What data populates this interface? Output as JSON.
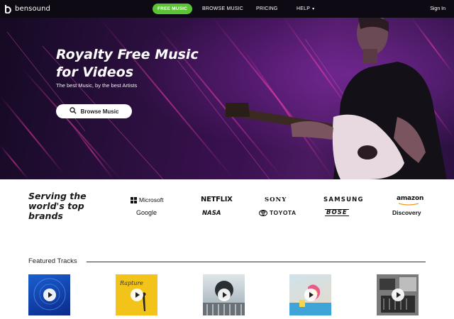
{
  "nav": {
    "logo_text": "bensound",
    "links": {
      "free_music": "FREE MUSIC",
      "browse_music": "BROWSE MUSIC",
      "pricing": "PRICING",
      "help": "HELP"
    },
    "sign_in": "Sign In"
  },
  "hero": {
    "title_line1": "Royalty Free Music",
    "title_line2": "for Videos",
    "subtitle": "The best Music, by the best Artists",
    "button_label": "Browse Music"
  },
  "brands": {
    "title_line1": "Serving the",
    "title_line2": "world's top",
    "title_line3": "brands",
    "logos": {
      "microsoft": "Microsoft",
      "netflix": "NETFLIX",
      "sony": "SONY",
      "samsung": "SAMSUNG",
      "amazon": "amazon",
      "google": "Google",
      "nasa": "NASA",
      "toyota": "TOYOTA",
      "bose": "BOSE",
      "discovery": "Discovery"
    }
  },
  "featured": {
    "title": "Featured Tracks",
    "track_cover_texts": {
      "track2": "Rapture"
    }
  },
  "colors": {
    "nav_bg": "#0d0a14",
    "accent_green": "#5bc435",
    "hero_purple": "#3a1150"
  }
}
